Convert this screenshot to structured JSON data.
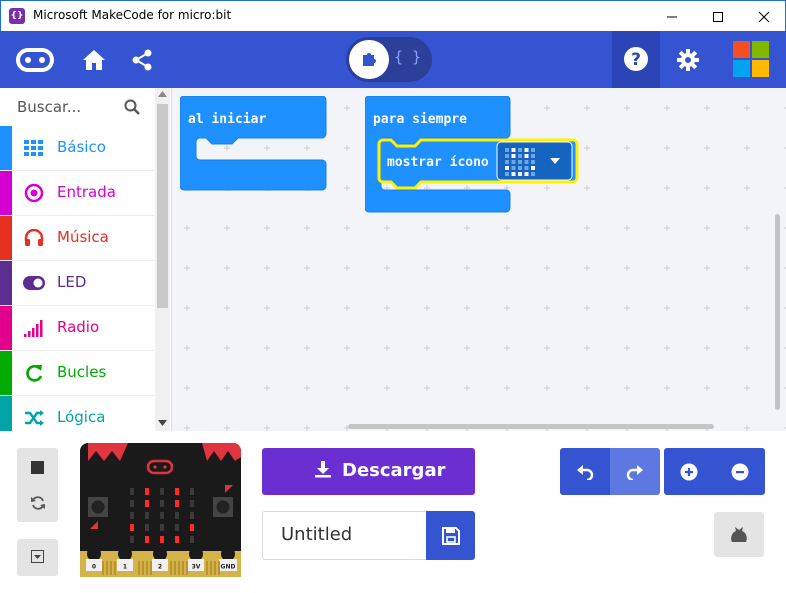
{
  "window": {
    "title": "Microsoft MakeCode for micro:bit",
    "app_icon_glyph": "{}"
  },
  "header": {
    "toggle_js_label": "{ }",
    "icons": [
      "microbit-logo-icon",
      "home-icon",
      "share-icon",
      "blocks-puzzle-icon",
      "help-icon",
      "settings-gear-icon",
      "microsoft-logo-icon"
    ]
  },
  "sidebar": {
    "search_placeholder": "Buscar...",
    "categories": [
      {
        "label": "Básico",
        "color": "#1e90ff",
        "icon": "grid-icon"
      },
      {
        "label": "Entrada",
        "color": "#d400d4",
        "icon": "target-icon"
      },
      {
        "label": "Música",
        "color": "#e63022",
        "icon": "headphones-icon"
      },
      {
        "label": "LED",
        "color": "#5c2d91",
        "icon": "toggle-icon"
      },
      {
        "label": "Radio",
        "color": "#e3008c",
        "icon": "signal-bars-icon"
      },
      {
        "label": "Bucles",
        "color": "#00aa00",
        "icon": "loop-arrow-icon"
      },
      {
        "label": "Lógica",
        "color": "#00a4a6",
        "icon": "shuffle-icon"
      }
    ]
  },
  "workspace": {
    "blocks": [
      {
        "id": "on-start",
        "label": "al iniciar"
      },
      {
        "id": "forever",
        "label": "para siempre"
      },
      {
        "id": "show-icon",
        "label": "mostrar ícono"
      }
    ]
  },
  "bottom": {
    "download_label": "Descargar",
    "project_name": "Untitled",
    "pin_labels": [
      "0",
      "1",
      "2",
      "3V",
      "GND"
    ]
  },
  "colors": {
    "header": "#3454d1",
    "download": "#6b2fd1",
    "block": "#1e90ff",
    "block_highlight": "#fff200"
  }
}
